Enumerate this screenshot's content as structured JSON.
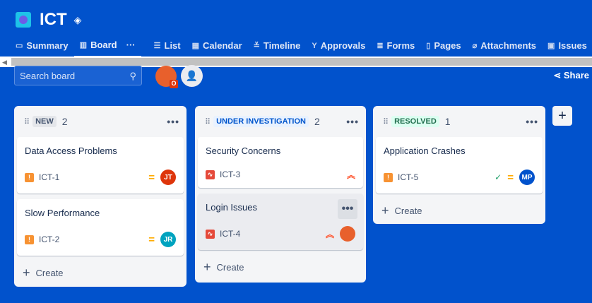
{
  "project": {
    "title": "ICT"
  },
  "tabs": [
    {
      "label": "Summary",
      "icon": "▭"
    },
    {
      "label": "Board",
      "icon": "▥",
      "more": "···"
    },
    {
      "label": "List",
      "icon": "☰"
    },
    {
      "label": "Calendar",
      "icon": "▦"
    },
    {
      "label": "Timeline",
      "icon": "≚"
    },
    {
      "label": "Approvals",
      "icon": "Y"
    },
    {
      "label": "Forms",
      "icon": "≣"
    },
    {
      "label": "Pages",
      "icon": "▯"
    },
    {
      "label": "Attachments",
      "icon": "⌀"
    },
    {
      "label": "Issues",
      "icon": "▣"
    }
  ],
  "search": {
    "placeholder": "Search board"
  },
  "share": "Share",
  "columns": [
    {
      "status": "NEW",
      "count": "2",
      "cards": [
        {
          "title": "Data Access Problems",
          "key": "ICT-1",
          "assignee": "JT"
        },
        {
          "title": "Slow Performance",
          "key": "ICT-2",
          "assignee": "JR"
        }
      ],
      "create": "Create"
    },
    {
      "status": "UNDER INVESTIGATION",
      "count": "2",
      "cards": [
        {
          "title": "Security Concerns",
          "key": "ICT-3"
        },
        {
          "title": "Login Issues",
          "key": "ICT-4"
        }
      ],
      "create": "Create"
    },
    {
      "status": "RESOLVED",
      "count": "1",
      "cards": [
        {
          "title": "Application Crashes",
          "key": "ICT-5",
          "assignee": "MP"
        }
      ],
      "create": "Create"
    }
  ]
}
